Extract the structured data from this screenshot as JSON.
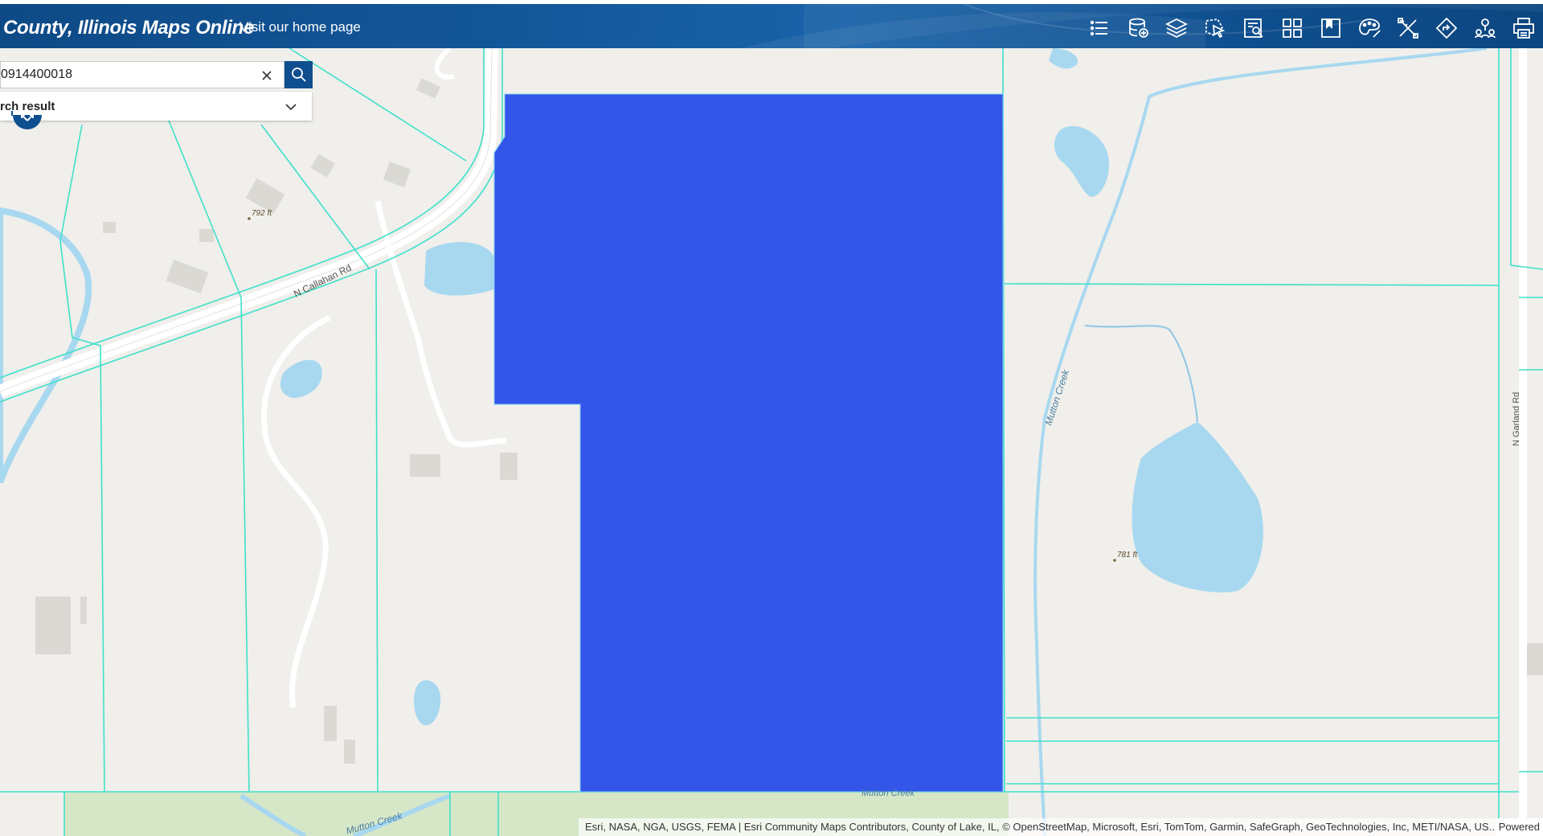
{
  "header": {
    "title": "County, Illinois Maps Online",
    "home_link": "Visit our home page",
    "tools": [
      {
        "icon": "list-icon"
      },
      {
        "icon": "database-add-icon"
      },
      {
        "icon": "layers-icon"
      },
      {
        "icon": "select-cursor-icon"
      },
      {
        "icon": "query-document-icon"
      },
      {
        "icon": "grid-icon"
      },
      {
        "icon": "bookmark-icon"
      },
      {
        "icon": "palette-icon"
      },
      {
        "icon": "measure-tools-icon"
      },
      {
        "icon": "directions-icon"
      },
      {
        "icon": "location-people-icon"
      },
      {
        "icon": "print-icon"
      }
    ]
  },
  "search": {
    "value": "0914400018",
    "result_label": "rch result"
  },
  "map": {
    "road_callahan": "N Callahan Rd",
    "road_garland": "N Garland Rd",
    "creek_1": "Mutton Creek",
    "creek_2": "Mutton Creek",
    "creek_3": "Mutton Creek",
    "elev_1": "792 ft",
    "elev_2": "781 ft",
    "highlight_color": "#3355e8",
    "parcel_line_color": "#3fe0c9"
  },
  "attribution": {
    "text": "Esri, NASA, NGA, USGS, FEMA | Esri Community Maps Contributors, County of Lake, IL, © OpenStreetMap, Microsoft, Esri, TomTom, Garmin, SafeGraph, GeoTechnologies, Inc, METI/NASA, US...",
    "powered": "Powered"
  }
}
